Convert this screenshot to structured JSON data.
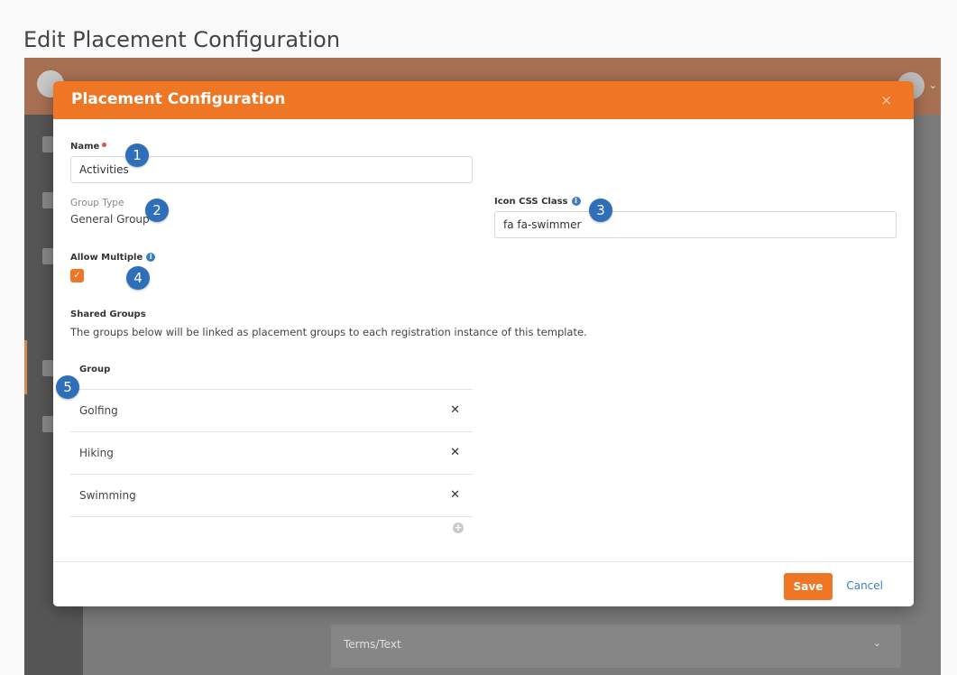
{
  "page": {
    "title": "Edit Placement Configuration"
  },
  "background": {
    "terms_label": "Terms/Text"
  },
  "modal": {
    "title": "Placement Configuration",
    "close_glyph": "×",
    "name": {
      "label": "Name",
      "value": "Activities"
    },
    "group_type": {
      "label": "Group Type",
      "value": "General Group"
    },
    "icon_css": {
      "label": "Icon CSS Class",
      "value": "fa fa-swimmer"
    },
    "allow_multiple": {
      "label": "Allow Multiple",
      "checked": true
    },
    "shared_groups": {
      "label": "Shared Groups",
      "help": "The groups below will be linked as placement groups to each registration instance of this template.",
      "column": "Group",
      "rows": [
        {
          "name": "Golfing"
        },
        {
          "name": "Hiking"
        },
        {
          "name": "Swimming"
        }
      ]
    },
    "footer": {
      "save": "Save",
      "cancel": "Cancel"
    }
  },
  "callouts": [
    "1",
    "2",
    "3",
    "4",
    "5"
  ],
  "colors": {
    "accent": "#ee7625",
    "link": "#3a7fc1",
    "callout": "#2f6fba"
  }
}
